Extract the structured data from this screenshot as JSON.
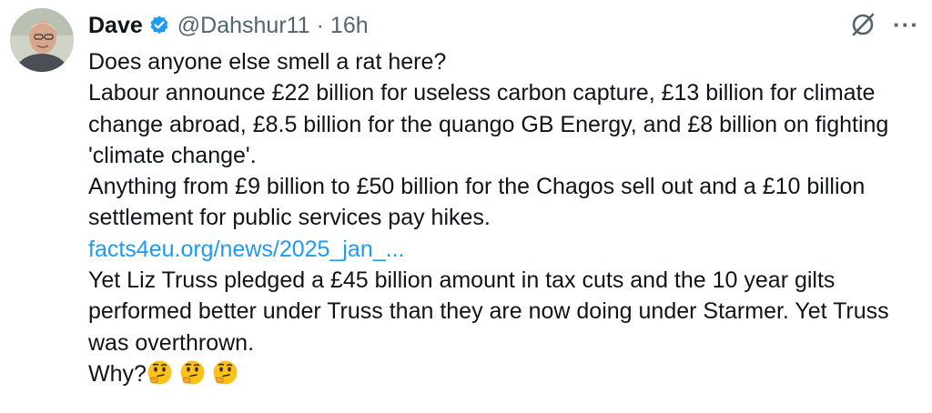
{
  "tweet": {
    "author": {
      "display_name": "Dave",
      "handle": "@Dahshur11",
      "separator": "·",
      "time": "16h",
      "verified_color": "#1d9bf0"
    },
    "icons": {
      "grok": "grok-icon",
      "more": "more-options-icon",
      "verified": "verified-badge-icon"
    },
    "more_label": "···",
    "text": {
      "line1": "Does anyone else smell a rat here?",
      "para1": "Labour announce £22 billion for useless carbon capture, £13 billion for climate change abroad, £8.5 billion for the quango GB Energy, and £8 billion on fighting 'climate change'.",
      "para2": "Anything from £9 billion to £50 billion for the Chagos sell out and a £10 billion settlement for public services pay hikes.",
      "link": "facts4eu.org/news/2025_jan_...",
      "para3": "Yet Liz Truss pledged a £45 billion amount in tax cuts and the 10 year gilts performed better under Truss than they are now doing under Starmer. Yet Truss was overthrown.",
      "final": "Why?",
      "emojis": [
        "thinking-face",
        "thinking-face",
        "thinking-face"
      ]
    },
    "colors": {
      "text": "#0f1419",
      "secondary": "#536471",
      "link": "#1d9bf0"
    }
  }
}
